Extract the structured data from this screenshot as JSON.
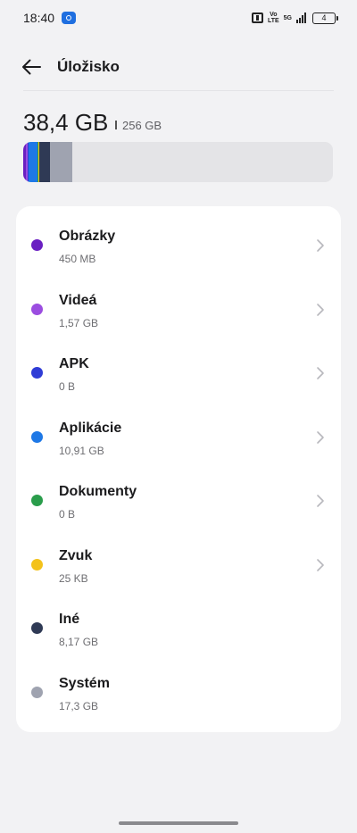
{
  "status_bar": {
    "time": "18:40",
    "net_top": "Vo",
    "net_bottom": "LTE",
    "gen": "5G",
    "battery": "4"
  },
  "header": {
    "title": "Úložisko"
  },
  "storage": {
    "used": "38,4 GB",
    "total": "256 GB",
    "segments": [
      {
        "name": "Obrázky",
        "color": "#6a1fc2"
      },
      {
        "name": "Videá",
        "color": "#9b4de0"
      },
      {
        "name": "APK",
        "color": "#2f3cd6"
      },
      {
        "name": "Aplikácie",
        "color": "#1e78e6"
      },
      {
        "name": "Dokumenty",
        "color": "#2a9d4b"
      },
      {
        "name": "Zvuk",
        "color": "#f3c21b"
      },
      {
        "name": "Iné",
        "color": "#2f3a55"
      },
      {
        "name": "Systém",
        "color": "#9fa3b0"
      }
    ],
    "remaining_color": "#e4e4e7"
  },
  "categories": [
    {
      "label": "Obrázky",
      "size": "450 MB",
      "color": "#6a1fc2",
      "chevron": true
    },
    {
      "label": "Videá",
      "size": "1,57 GB",
      "color": "#9b4de0",
      "chevron": true
    },
    {
      "label": "APK",
      "size": "0 B",
      "color": "#2f3cd6",
      "chevron": true
    },
    {
      "label": "Aplikácie",
      "size": "10,91  GB",
      "color": "#1e78e6",
      "chevron": true
    },
    {
      "label": "Dokumenty",
      "size": "0 B",
      "color": "#2a9d4b",
      "chevron": true
    },
    {
      "label": "Zvuk",
      "size": "25 KB",
      "color": "#f3c21b",
      "chevron": true
    },
    {
      "label": "Iné",
      "size": "8,17 GB",
      "color": "#2f3a55",
      "chevron": false
    },
    {
      "label": "Systém",
      "size": "17,3 GB",
      "color": "#9fa3b0",
      "chevron": false
    }
  ]
}
